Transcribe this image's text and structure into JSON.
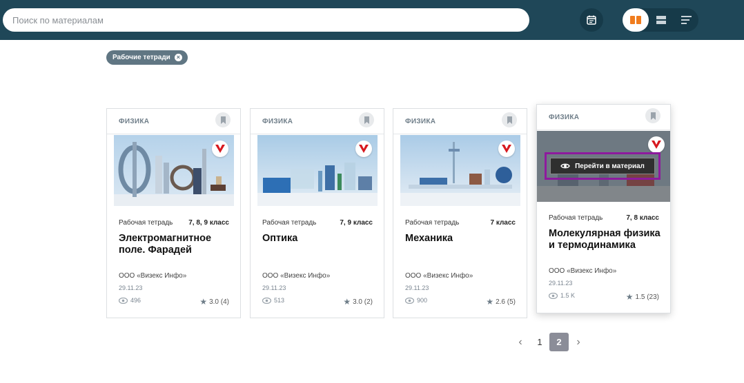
{
  "search": {
    "placeholder": "Поиск по материалам",
    "value": ""
  },
  "toolbar": {
    "calendar_icon": "calendar-icon",
    "view_modes": [
      "grid-view-icon",
      "list-view-icon",
      "compact-view-icon"
    ],
    "active_view": "grid-view-icon",
    "accent": "#f07c1e"
  },
  "filters": {
    "chip_label": "Рабочие тетради",
    "chip_remove": "×"
  },
  "cards": [
    {
      "subject": "ФИЗИКА",
      "type": "Рабочая тетрадь",
      "grade": "7, 8, 9 класс",
      "title": "Электромагнитное поле. Фарадей",
      "org": "ООО «Визекс Инфо»",
      "date": "29.11.23",
      "views": "496",
      "rating": "3.0 (4)"
    },
    {
      "subject": "ФИЗИКА",
      "type": "Рабочая тетрадь",
      "grade": "7, 9 класс",
      "title": "Оптика",
      "org": "ООО «Визекс Инфо»",
      "date": "29.11.23",
      "views": "513",
      "rating": "3.0 (2)"
    },
    {
      "subject": "ФИЗИКА",
      "type": "Рабочая тетрадь",
      "grade": "7 класс",
      "title": "Механика",
      "org": "ООО «Визекс Инфо»",
      "date": "29.11.23",
      "views": "900",
      "rating": "2.6 (5)"
    },
    {
      "subject": "ФИЗИКА",
      "type": "Рабочая тетрадь",
      "grade": "7, 8 класс",
      "title": "Молекулярная физика и термодинамика",
      "org": "ООО «Визекс Инфо»",
      "date": "29.11.23",
      "views": "1.5 K",
      "rating": "1.5 (23)",
      "hover_action": "Перейти в материал"
    }
  ],
  "pagination": {
    "prev": "‹",
    "pages": [
      "1",
      "2"
    ],
    "current": "2",
    "next": "›"
  }
}
